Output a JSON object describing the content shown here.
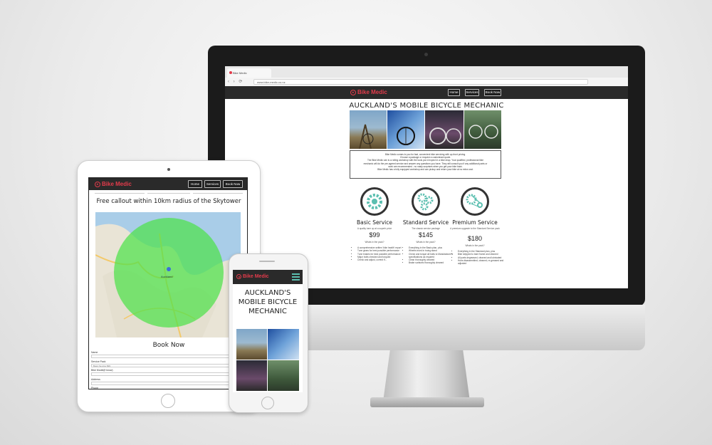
{
  "site": {
    "brand": "Bike Medic",
    "nav": [
      {
        "label": "Home"
      },
      {
        "label": "Services"
      },
      {
        "label": "Book Now"
      }
    ],
    "accent_color": "#e33b4b",
    "nav_color": "#2a2a2a"
  },
  "desktop": {
    "tab_label": "Bike Medic",
    "url": "www.bike-medic.co.nz",
    "hero_title": "AUCKLAND'S MOBILE BICYCLE MECHANIC",
    "intro_lines": [
      "Bike Medic comes to you for fast, convenient bike servicing with up-front pricing.",
      "Choose a package or request a customised quote.",
      "The Bike Medic van is a rolling workshop with the tools you'd expect in a bike shop. Your qualified, professional bike",
      "mechanic will do the pre-agreed service and answer any questions you have. They will consult you if any additional parts or",
      "work are recommended - no nasty surprises when you get your bike back.",
      "Bike Medic has a fully equipped workshop and can pickup and return your bike at no extra cost."
    ],
    "services": [
      {
        "icon": "single-cog-icon",
        "title": "Basic Service",
        "subtitle": "A quality tune up at a superb price",
        "price": "$99",
        "whats_in": "Whats in the pack?",
        "items": [
          "A comprehensive written 'bike health' report",
          "Tune gears for best possible performance",
          "Tune brakes for best possible performance",
          "Major bolts checked and torqued",
          "Check and adjust, correct if..."
        ]
      },
      {
        "icon": "multi-cog-icon",
        "title": "Standard Service",
        "subtitle": "The classic service package",
        "price": "$145",
        "whats_in": "Whats in the pack?",
        "items": [
          "Everything in the Basic plan, plus",
          "Wheels trued in truing stand",
          "Check and torque all bolts to Manufacturer's specifications as required",
          "Clean thoroughly cleaned",
          "Brake surfaces thoroughly cleaned"
        ]
      },
      {
        "icon": "chain-drive-icon",
        "title": "Premium Service",
        "subtitle": "A premium upgrade to the Standard Service pack",
        "price": "$180",
        "whats_in": "Whats in the pack?",
        "items": [
          "Everything in the Standard plan, plus",
          "Bike stripped to bare frame and cleaned",
          "All parts degreased, cleaned and lubricated",
          "Hubs disassembled, cleaned, re-greased and adjusted"
        ]
      }
    ]
  },
  "tablet": {
    "heading": "Free callout within 10km radius of the Skytower",
    "map_label": "Auckland",
    "book_title": "Book Now",
    "form": [
      {
        "label": "Name",
        "value": ""
      },
      {
        "label": "Service Pack",
        "value": "Basic Service $99"
      },
      {
        "label": "Bike Model(if know)",
        "value": ""
      },
      {
        "label": "Address",
        "value": ""
      },
      {
        "label": "Phone",
        "value": ""
      }
    ]
  },
  "phone": {
    "hero_title_lines": [
      "AUCKLAND'S",
      "MOBILE BICYCLE",
      "MECHANIC"
    ]
  }
}
